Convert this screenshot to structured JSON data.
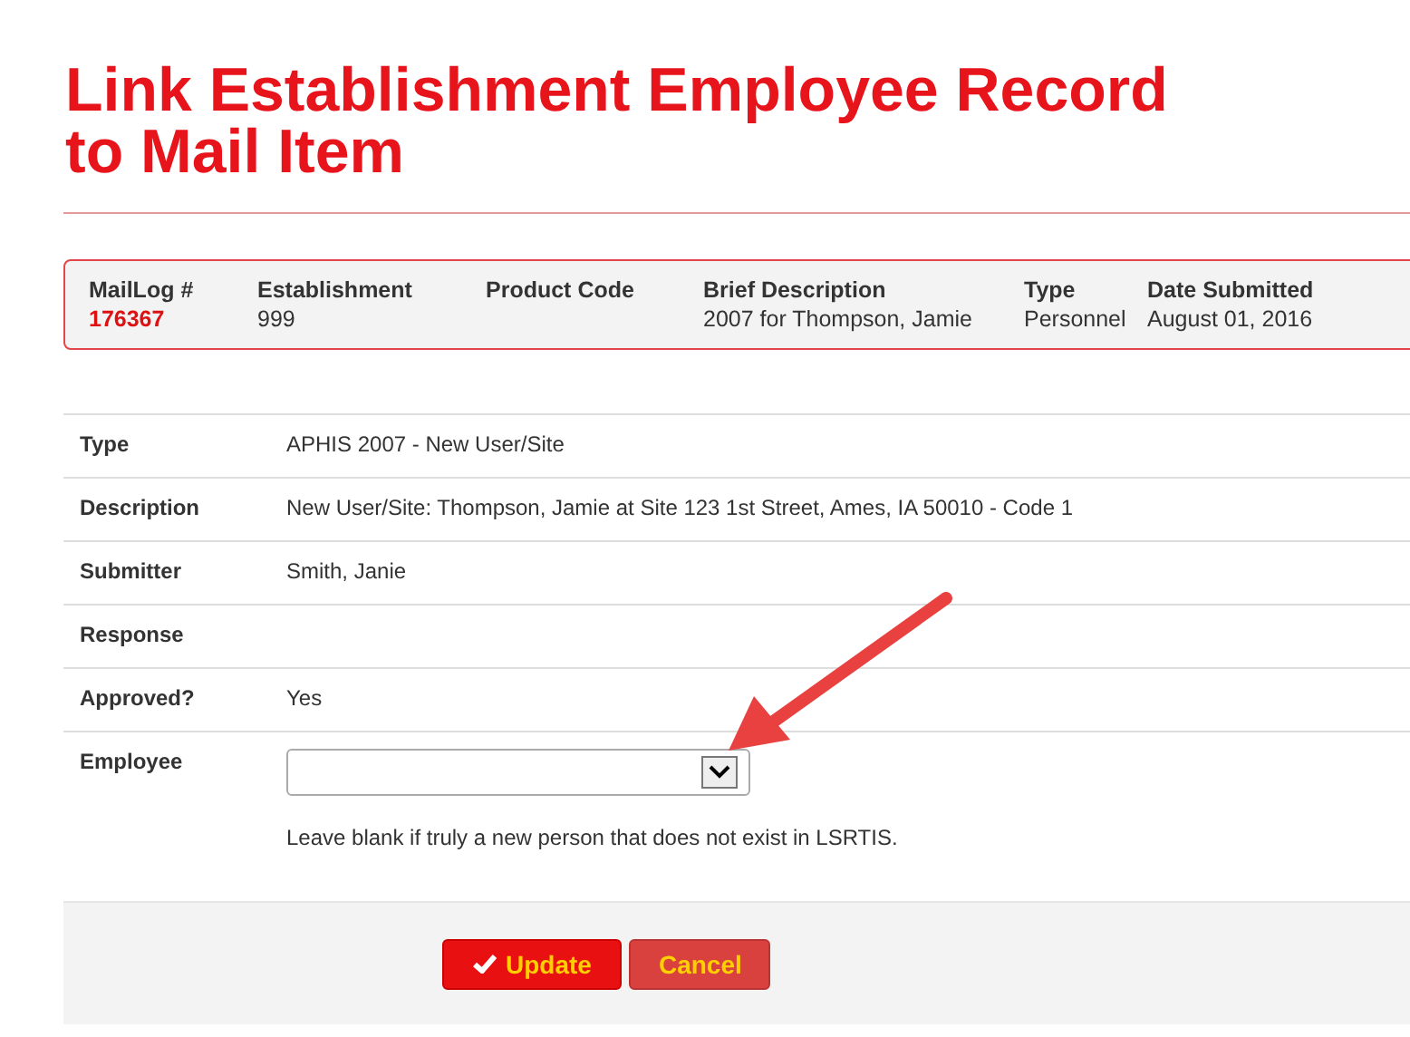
{
  "title": "Link Establishment Employee Record to Mail Item",
  "summary": {
    "columns": [
      {
        "label": "MailLog #",
        "value": "176367",
        "kind": "link"
      },
      {
        "label": "Establishment",
        "value": "999",
        "kind": "text"
      },
      {
        "label": "Product Code",
        "kind": "text"
      },
      {
        "label": "Brief Description",
        "value": "2007 for Thompson, Jamie",
        "kind": "text"
      },
      {
        "label": "Type",
        "value": "Personnel",
        "kind": "text"
      },
      {
        "label": "Date Submitted",
        "value": "August 01, 2016",
        "kind": "text"
      }
    ]
  },
  "details": [
    {
      "label": "Type",
      "value": "APHIS 2007 - New User/Site",
      "kind": "text"
    },
    {
      "label": "Description",
      "value": "New User/Site: Thompson, Jamie at Site 123 1st Street, Ames, IA 50010 - Code 1",
      "kind": "text"
    },
    {
      "label": "Submitter",
      "value": "Smith, Janie",
      "kind": "text"
    },
    {
      "label": "Response",
      "kind": "text"
    },
    {
      "label": "Approved?",
      "value": "Yes",
      "kind": "text"
    },
    {
      "label": "Employee",
      "kind": "select",
      "help": "Leave blank if truly a new person that does not exist in LSRTIS."
    }
  ],
  "buttons": [
    {
      "label": "Update",
      "kind": "primary"
    },
    {
      "label": "Cancel",
      "kind": "secondary"
    }
  ]
}
